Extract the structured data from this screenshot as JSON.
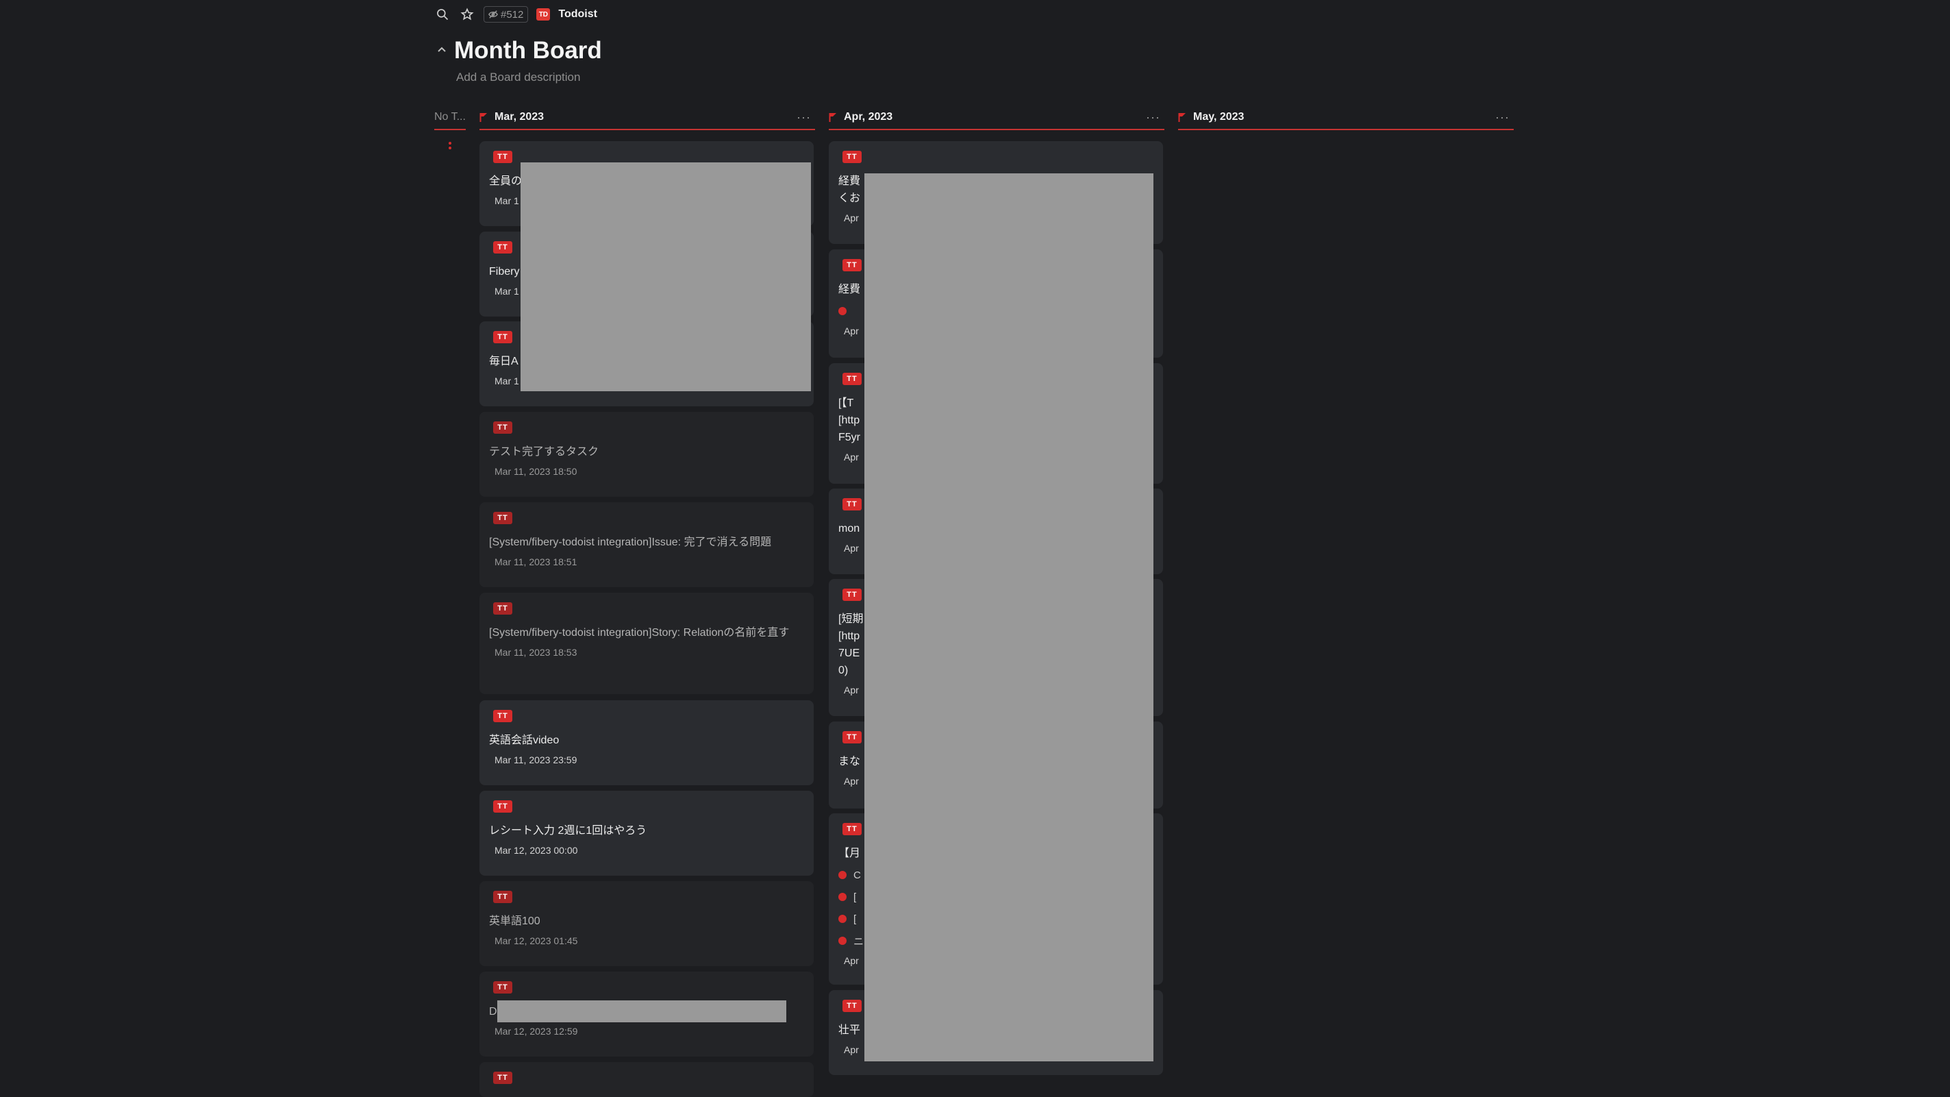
{
  "topbar": {
    "issue_id": "#512",
    "app_logo": "TD",
    "app_name": "Todoist"
  },
  "board": {
    "title": "Month Board",
    "description_placeholder": "Add a Board description"
  },
  "no_tag_column": {
    "title": "No T..."
  },
  "columns": [
    {
      "title": "Mar, 2023"
    },
    {
      "title": "Apr, 2023"
    },
    {
      "title": "May, 2023"
    }
  ],
  "card_tag": "TT",
  "more_label": "···",
  "mar_cards": [
    {
      "title": "全員の",
      "date": "Mar 1"
    },
    {
      "title": "Fibery",
      "date": "Mar 1"
    },
    {
      "title": "毎日A",
      "date": "Mar 1"
    },
    {
      "title": "テスト完了するタスク",
      "date": "Mar 11, 2023 18:50"
    },
    {
      "title": "[System/fibery-todoist integration]Issue: 完了で消える問題",
      "date": "Mar 11, 2023 18:51"
    },
    {
      "title": "[System/fibery-todoist integration]Story: Relationの名前を直す",
      "date": "Mar 11, 2023 18:53"
    },
    {
      "title": "英語会話video",
      "date": "Mar 11, 2023 23:59"
    },
    {
      "title": "レシート入力 2週に1回はやろう",
      "date": "Mar 12, 2023 00:00"
    },
    {
      "title": "英単語100",
      "date": "Mar 12, 2023 01:45"
    },
    {
      "title": "D",
      "date": "Mar 12, 2023 12:59"
    },
    {
      "title": "",
      "date": ""
    }
  ],
  "apr_cards": [
    {
      "title": "経費\nくお",
      "date": "Apr"
    },
    {
      "title": "経費",
      "sub": [
        "",
        ""
      ],
      "date": "Apr"
    },
    {
      "title": "[【T\n[http\nF5yr",
      "date": "Apr"
    },
    {
      "title": "mon",
      "date": "Apr"
    },
    {
      "title": "[短期\n[http\n7UE\n0)",
      "date": "Apr"
    },
    {
      "title": "まな",
      "date": "Apr"
    },
    {
      "title": "【月",
      "sub": [
        "C",
        "[",
        "[",
        "ニ"
      ],
      "date": "Apr"
    },
    {
      "title": "壮平",
      "date": "Apr"
    }
  ]
}
